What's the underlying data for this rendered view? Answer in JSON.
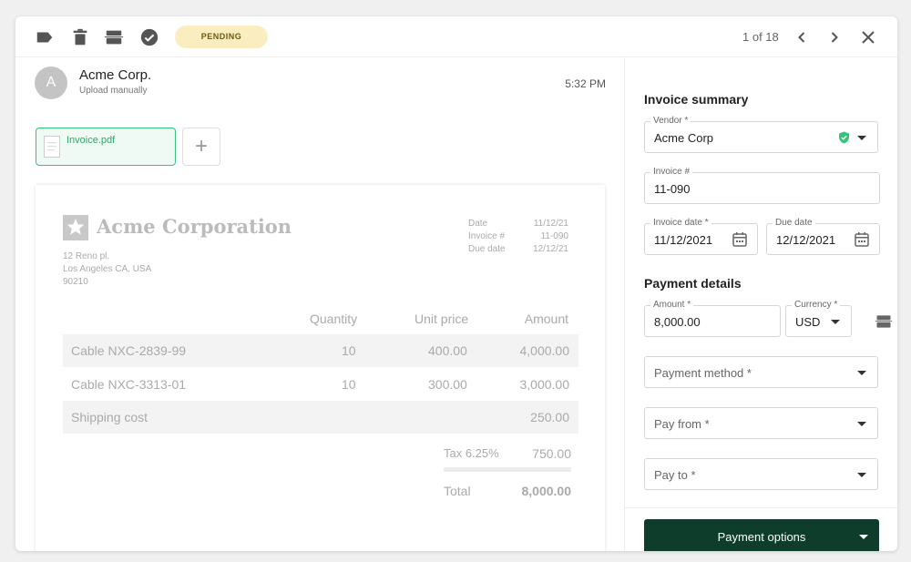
{
  "toolbar": {
    "status_badge": "PENDING",
    "pager": "1 of 18"
  },
  "message": {
    "avatar_letter": "A",
    "sender": "Acme Corp.",
    "source": "Upload manually",
    "time": "5:32 PM",
    "attachment": "Invoice.pdf"
  },
  "invoice": {
    "company": "Acme Corporation",
    "address": [
      "12 Reno pl.",
      "Los Angeles CA, USA",
      "90210"
    ],
    "meta_labels": [
      "Date",
      "Invoice #",
      "Due date"
    ],
    "meta_values": [
      "11/12/21",
      "11-090",
      "12/12/21"
    ],
    "columns": [
      "Quantity",
      "Unit price",
      "Amount"
    ],
    "rows": [
      {
        "item": "Cable NXC-2839-99",
        "qty": "10",
        "price": "400.00",
        "amount": "4,000.00"
      },
      {
        "item": "Cable NXC-3313-01",
        "qty": "10",
        "price": "300.00",
        "amount": "3,000.00"
      },
      {
        "item": "Shipping cost",
        "qty": "",
        "price": "",
        "amount": "250.00"
      }
    ],
    "tax_label": "Tax 6.25%",
    "tax_value": "750.00",
    "total_label": "Total",
    "total_value": "8,000.00"
  },
  "summary": {
    "title": "Invoice summary",
    "vendor_label": "Vendor *",
    "vendor_value": "Acme Corp",
    "invoice_no_label": "Invoice #",
    "invoice_no_value": "11-090",
    "invoice_date_label": "Invoice date *",
    "invoice_date_value": "11/12/2021",
    "due_date_label": "Due date",
    "due_date_value": "12/12/2021"
  },
  "payment": {
    "title": "Payment details",
    "amount_label": "Amount *",
    "amount_value": "8,000.00",
    "currency_label": "Currency *",
    "currency_value": "USD",
    "method_placeholder": "Payment method *",
    "from_placeholder": "Pay from *",
    "to_placeholder": "Pay to *",
    "button_label": "Payment options"
  },
  "colors": {
    "accent_green": "#34c47c",
    "button_dark_green": "#0f3d2b",
    "badge_bg": "#faeec0"
  },
  "icons": [
    "tag-icon",
    "trash-icon",
    "archive-icon",
    "check-circle-icon",
    "chevron-left-icon",
    "chevron-right-icon",
    "close-icon",
    "calendar-icon",
    "shield-check-icon",
    "file-icon",
    "plus-icon"
  ]
}
